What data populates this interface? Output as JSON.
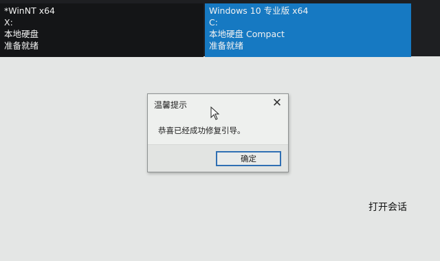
{
  "os_tiles": [
    {
      "name": "*WinNT x64",
      "drive": "X:",
      "disk": "本地硬盘",
      "status": "准备就绪"
    },
    {
      "name": "Windows 10 专业版 x64",
      "drive": "C:",
      "disk": "本地硬盘 Compact",
      "status": "准备就绪"
    }
  ],
  "dialog": {
    "title": "温馨提示",
    "close_icon": "close-icon",
    "message": "恭喜已经成功修复引导。",
    "ok_label": "确定"
  },
  "cursor_icon": "arrow-cursor-icon",
  "open_session_label": "打开会话",
  "colors": {
    "selected_tile": "#1679c2",
    "dark_tile": "#141517",
    "background": "#e4e6e5",
    "button_border": "#2f6fb3"
  }
}
